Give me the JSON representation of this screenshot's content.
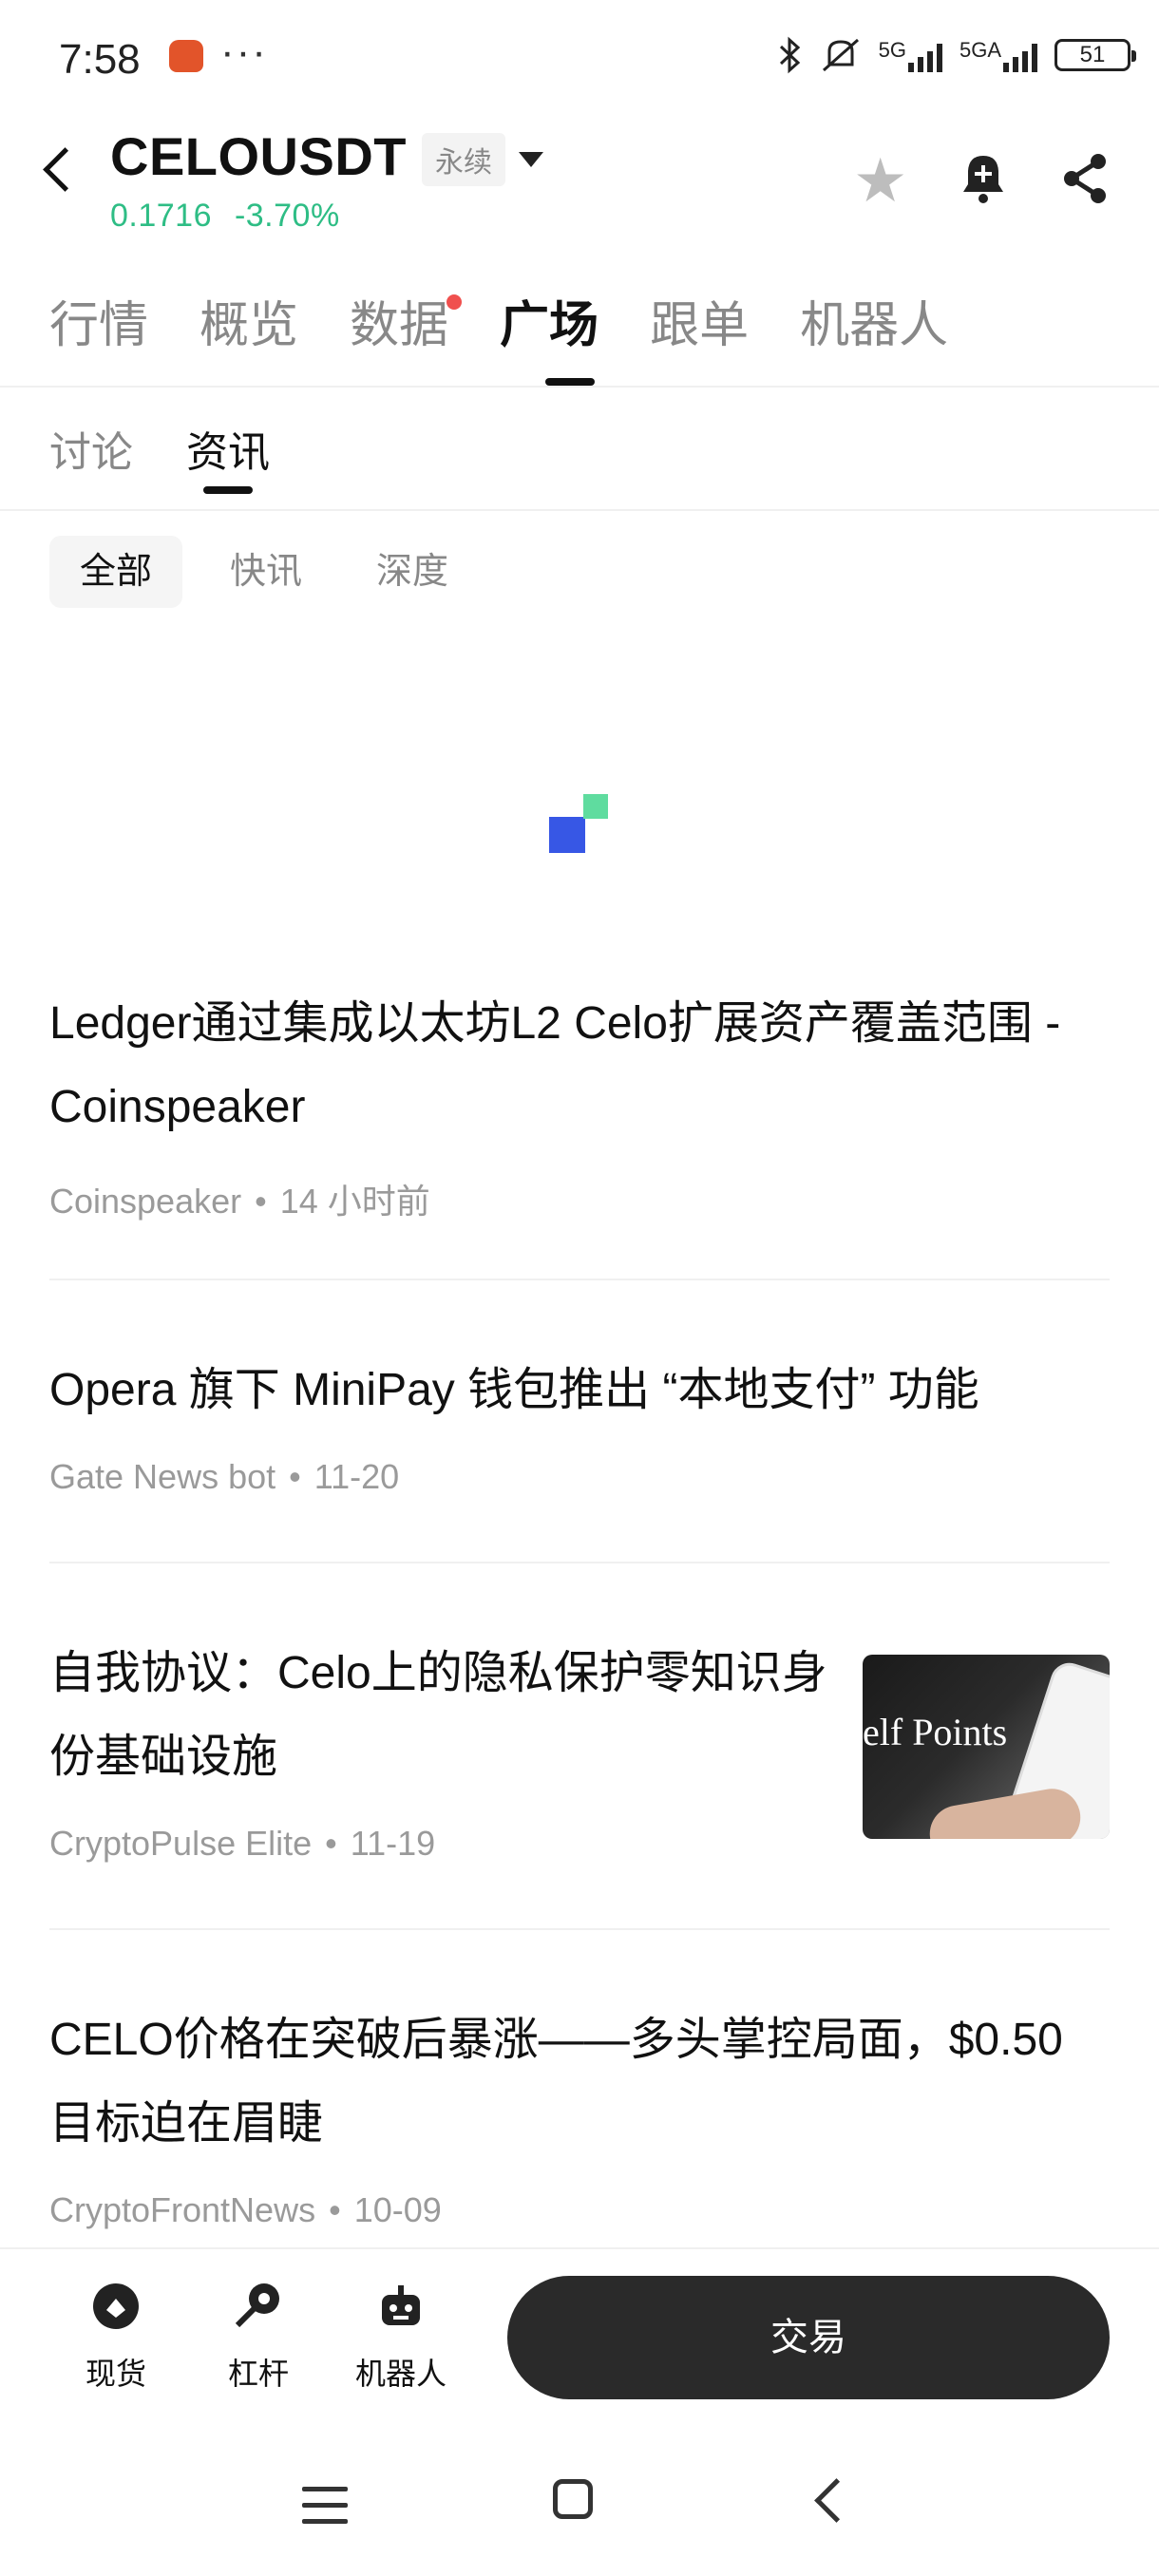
{
  "status_bar": {
    "time": "7:58",
    "more": "···",
    "net1": "5G",
    "net2": "5GA",
    "battery": "51"
  },
  "header": {
    "pair": "CELOUSDT",
    "contract_type": "永续",
    "price": "0.1716",
    "change": "-3.70%",
    "accent_up": "#2ebd85"
  },
  "main_tabs": [
    {
      "label": "行情"
    },
    {
      "label": "概览"
    },
    {
      "label": "数据"
    },
    {
      "label": "广场"
    },
    {
      "label": "跟单"
    },
    {
      "label": "机器人"
    }
  ],
  "sub_tabs": [
    {
      "label": "讨论"
    },
    {
      "label": "资讯"
    }
  ],
  "filters": [
    {
      "label": "全部"
    },
    {
      "label": "快讯"
    },
    {
      "label": "深度"
    }
  ],
  "news": [
    {
      "title": "Ledger通过集成以太坊L2 Celo扩展资产覆盖范围 - Coinspeaker",
      "source": "Coinspeaker",
      "time": "14 小时前"
    },
    {
      "title": "Opera 旗下 MiniPay 钱包推出 “本地支付” 功能",
      "source": "Gate News bot",
      "time": "11-20"
    },
    {
      "title": "自我协议：Celo上的隐私保护零知识身份基础设施",
      "source": "CryptoPulse Elite",
      "time": "11-19",
      "thumbnail_text": "elf Points"
    },
    {
      "title": "CELO价格在突破后暴涨——多头掌控局面，$0.50目标迫在眉睫",
      "source": "CryptoFrontNews",
      "time": "10-09"
    }
  ],
  "bottom_bar": {
    "spot": "现货",
    "margin": "杠杆",
    "bot": "机器人",
    "trade": "交易"
  }
}
